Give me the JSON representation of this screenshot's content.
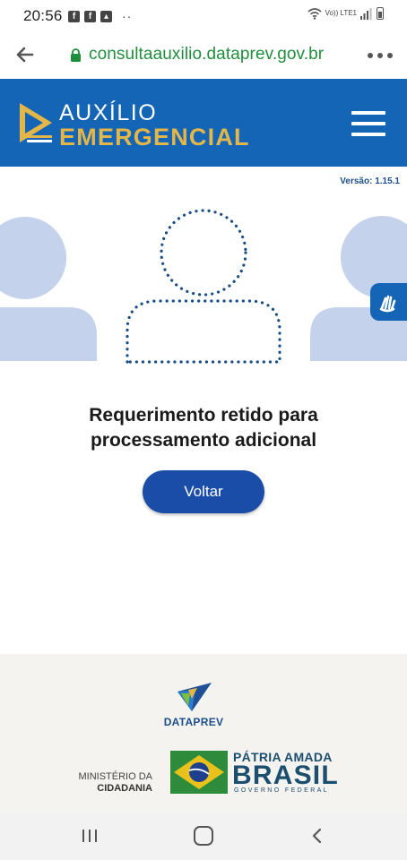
{
  "status_bar": {
    "time": "20:56",
    "left_icons": [
      "facebook-icon",
      "facebook-icon",
      "image-icon"
    ],
    "overflow": "··",
    "network": "Vo)) LTE1"
  },
  "browser": {
    "url": "consultaauxilio.dataprev.gov.br",
    "url_color": "#1f8e3d"
  },
  "header": {
    "logo_line1": "AUXÍLIO",
    "logo_line2": "EMERGENCIAL",
    "background": "#1465b5",
    "accent": "#e3b64a"
  },
  "version": "Versão: 1.15.1",
  "main": {
    "message_line1": "Requerimento retido para",
    "message_line2": "processamento adicional",
    "back_button_label": "Voltar"
  },
  "footer": {
    "dataprev_label": "DATAPREV",
    "ministerio_line1": "MINISTÉRIO DA",
    "ministerio_line2": "CIDADANIA",
    "patria_line1": "PÁTRIA AMADA",
    "patria_line2": "BRASIL",
    "patria_line3": "GOVERNO FEDERAL"
  }
}
